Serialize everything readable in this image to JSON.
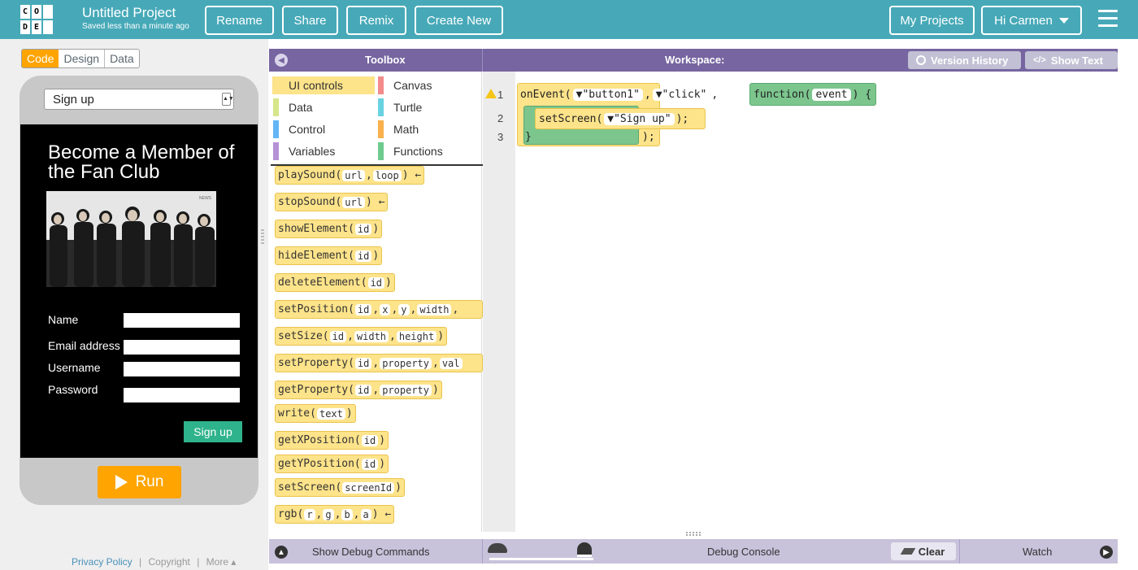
{
  "header": {
    "logo_letters": [
      "C",
      "O",
      "",
      "D",
      "E",
      ""
    ],
    "project_title": "Untitled Project",
    "saved_status": "Saved less than a minute ago",
    "buttons": {
      "rename": "Rename",
      "share": "Share",
      "remix": "Remix",
      "create_new": "Create New",
      "my_projects": "My Projects",
      "user": "Hi Carmen"
    },
    "colors": {
      "bar": "#47a9b8"
    }
  },
  "left": {
    "tabs": [
      "Code",
      "Design",
      "Data"
    ],
    "active_tab": "Code",
    "screen_select": "Sign up",
    "app": {
      "title": "Become a Member of the Fan Club",
      "photo_caption": "NEWS",
      "fields": [
        "Name",
        "Email address",
        "Username",
        "Password"
      ],
      "submit": "Sign up"
    },
    "run": "Run",
    "footer": {
      "privacy": "Privacy Policy",
      "sep1": "|",
      "copyright": "Copyright",
      "sep2": "|",
      "more": "More ▴"
    }
  },
  "toolbox": {
    "title": "Toolbox",
    "categories": [
      {
        "label": "UI controls",
        "color": "#fde38a"
      },
      {
        "label": "Canvas",
        "color": "#f38b8b"
      },
      {
        "label": "Data",
        "color": "#d6e68a"
      },
      {
        "label": "Turtle",
        "color": "#68d2e0"
      },
      {
        "label": "Control",
        "color": "#64b5f6"
      },
      {
        "label": "Math",
        "color": "#f9b04d"
      },
      {
        "label": "Variables",
        "color": "#b592d6"
      },
      {
        "label": "Functions",
        "color": "#6ecb8e"
      }
    ],
    "blocks": {
      "b0": {
        "name": "playSound(",
        "a1": "url",
        ",": ",",
        "a2": "loop",
        ")": ") ←"
      },
      "b1": {
        "name": "stopSound(",
        "a1": "url",
        ")": ") ←"
      },
      "b2": {
        "name": "showElement(",
        "a1": "id",
        ")": ")"
      },
      "b3": {
        "name": "hideElement(",
        "a1": "id",
        ")": ")"
      },
      "b4": {
        "name": "deleteElement(",
        "a1": "id",
        ")": ")"
      },
      "b5": {
        "name": "setPosition(",
        "a1": "id",
        "a2": "x",
        "a3": "y",
        "a4": "width"
      },
      "b6": {
        "name": "setSize(",
        "a1": "id",
        "a2": "width",
        "a3": "height",
        ")": ")"
      },
      "b7": {
        "name": "setProperty(",
        "a1": "id",
        "a2": "property",
        "a3": "val"
      },
      "b8": {
        "name": "getProperty(",
        "a1": "id",
        "a2": "property",
        ")": ")"
      },
      "b9": {
        "name": "write(",
        "a1": "text",
        ")": ")"
      },
      "b10": {
        "name": "getXPosition(",
        "a1": "id",
        ")": ")"
      },
      "b11": {
        "name": "getYPosition(",
        "a1": "id",
        ")": ")"
      },
      "b12": {
        "name": "setScreen(",
        "a1": "screenId",
        ")": ")"
      },
      "b13": {
        "name": "rgb(",
        "a1": "r",
        "a2": "g",
        "a3": "b",
        "a4": "a",
        ")": ") ←"
      }
    }
  },
  "workspace": {
    "title": "Workspace:",
    "version_history": "Version History",
    "show_text": "Show Text",
    "line_numbers": [
      "1",
      "2",
      "3"
    ],
    "code": {
      "onEvent": "onEvent(",
      "arg1": "▼\"button1\"",
      "arg2": "▼\"click\"",
      "comma": ",",
      "function": "function(",
      "event": "event",
      "fclose": ") {",
      "setScreen": "setScreen(",
      "screen_arg": "▼\"Sign up\"",
      "stmt_end": ");",
      "brace": "}",
      "outer_end": ");"
    }
  },
  "bottom": {
    "debug_commands": "Show Debug Commands",
    "debug_console": "Debug Console",
    "clear": "Clear",
    "watch": "Watch"
  }
}
